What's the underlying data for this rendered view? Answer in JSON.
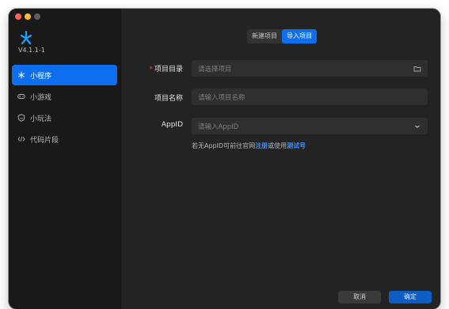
{
  "window": {
    "controls": [
      "close",
      "minimize",
      "maximize"
    ]
  },
  "app": {
    "logo_icon": "wechat-devtools-logo",
    "version": "V4.1.1-1"
  },
  "sidebar": {
    "items": [
      {
        "label": "小程序",
        "icon": "asterisk-icon",
        "active": true
      },
      {
        "label": "小游戏",
        "icon": "gamepad-icon",
        "active": false
      },
      {
        "label": "小玩法",
        "icon": "shield-smile-icon",
        "active": false
      },
      {
        "label": "代码片段",
        "icon": "code-icon",
        "active": false
      }
    ]
  },
  "tabs": {
    "new_label": "新建项目",
    "import_label": "导入项目",
    "active": "import"
  },
  "form": {
    "directory": {
      "label": "项目目录",
      "required": true,
      "placeholder": "请选择项目",
      "icon": "folder-icon"
    },
    "name": {
      "label": "项目名称",
      "placeholder": "请输入项目名称"
    },
    "appid": {
      "label": "AppID",
      "placeholder": "请输入AppID",
      "icon": "chevron-down-icon"
    },
    "hint": {
      "prefix": "若无AppID可前往官网",
      "register_link": "注册",
      "middle": "或使用",
      "test_link": "测试号"
    }
  },
  "footer": {
    "cancel_label": "取消",
    "confirm_label": "确定"
  },
  "colors": {
    "accent": "#0d6ff0",
    "link": "#3b8cff",
    "required": "#e5484d",
    "sidebar_bg": "#191919",
    "main_bg": "#232323",
    "field_bg": "#2f2f2f"
  }
}
